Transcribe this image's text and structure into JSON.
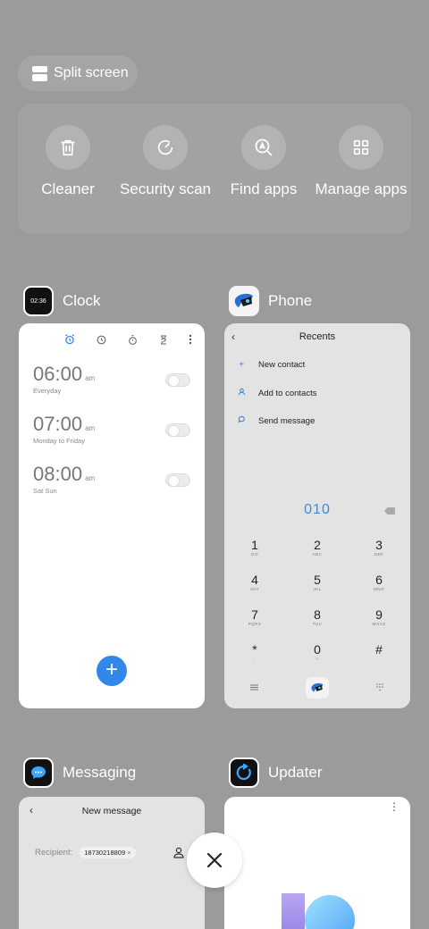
{
  "split_screen": {
    "label": "Split screen"
  },
  "tools": [
    {
      "label": "Cleaner",
      "icon": "trash-icon"
    },
    {
      "label": "Security scan",
      "icon": "security-scan-icon"
    },
    {
      "label": "Find apps",
      "icon": "find-apps-icon"
    },
    {
      "label": "Manage apps",
      "icon": "manage-apps-icon"
    }
  ],
  "apps": {
    "clock": {
      "name": "Clock",
      "icon_text": "02:36",
      "alarms": [
        {
          "time": "06:00",
          "ampm": "am",
          "repeat": "Everyday"
        },
        {
          "time": "07:00",
          "ampm": "am",
          "repeat": "Monday to Friday"
        },
        {
          "time": "08:00",
          "ampm": "am",
          "repeat": "Sat Sun"
        }
      ],
      "fab": "+"
    },
    "phone": {
      "name": "Phone",
      "title": "Recents",
      "actions": [
        "New contact",
        "Add to contacts",
        "Send message"
      ],
      "dialed": "010",
      "keys": [
        {
          "d": "1",
          "l": "GO"
        },
        {
          "d": "2",
          "l": "ABC"
        },
        {
          "d": "3",
          "l": "DEF"
        },
        {
          "d": "4",
          "l": "GHI"
        },
        {
          "d": "5",
          "l": "JKL"
        },
        {
          "d": "6",
          "l": "MNO"
        },
        {
          "d": "7",
          "l": "PQRS"
        },
        {
          "d": "8",
          "l": "TUV"
        },
        {
          "d": "9",
          "l": "WXYZ"
        },
        {
          "d": "*",
          "l": ","
        },
        {
          "d": "0",
          "l": "+"
        },
        {
          "d": "#",
          "l": ""
        }
      ]
    },
    "messaging": {
      "name": "Messaging",
      "title": "New message",
      "recipient_label": "Recipient:",
      "recipient": "18730218809"
    },
    "updater": {
      "name": "Updater"
    }
  },
  "colors": {
    "background": "#9b9b9b",
    "accent": "#3287eb"
  }
}
